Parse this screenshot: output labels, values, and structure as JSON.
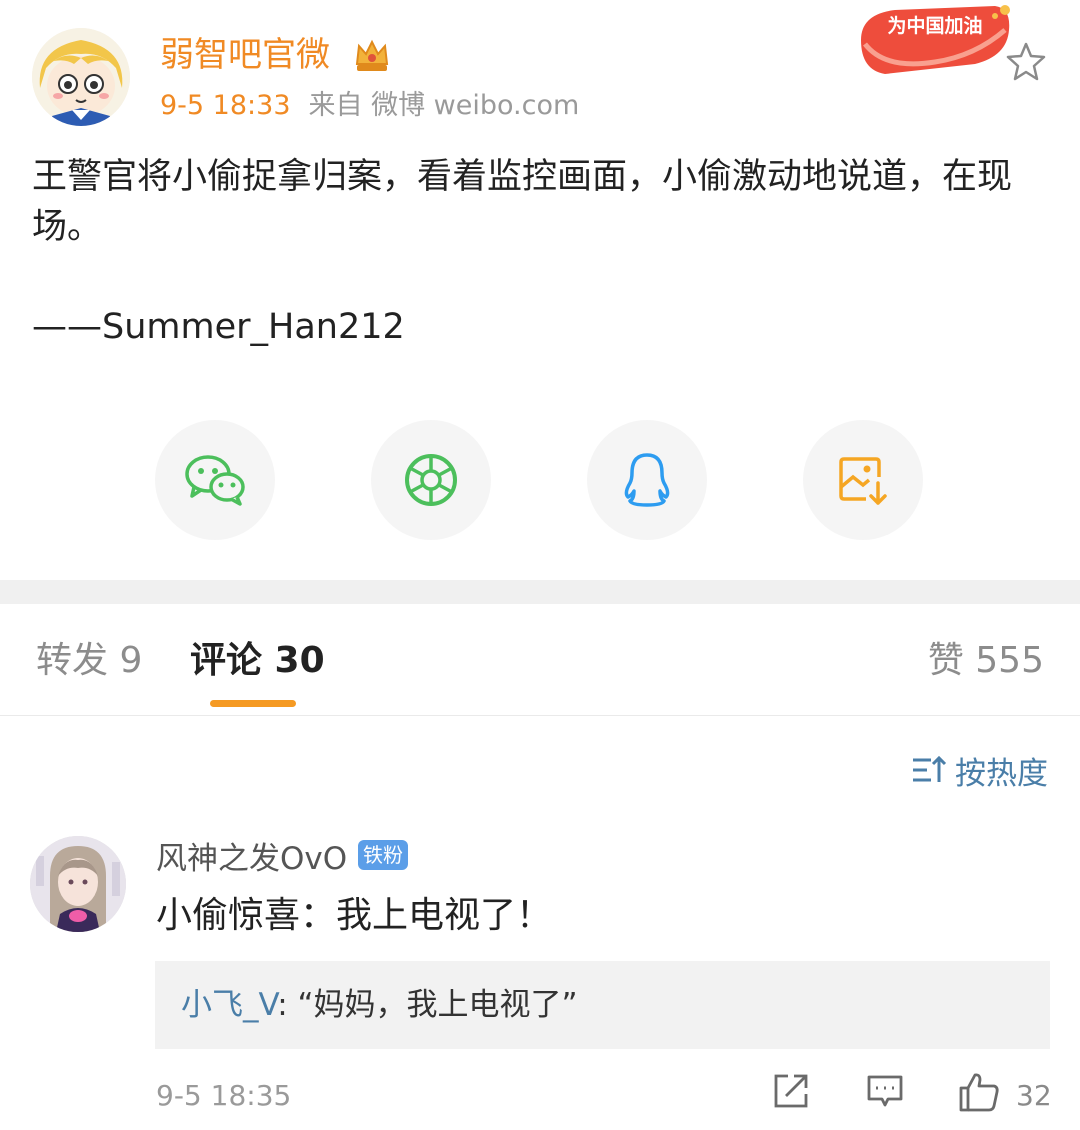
{
  "post": {
    "author": "弱智吧官微",
    "time": "9-5 18:33",
    "source": "来自 微博 weibo.com",
    "badge_text": "为中国加油",
    "body": "王警官将小偷捉拿归案，看着监控画面，小偷激动地说道，在现场。",
    "signature": "——Summer_Han212"
  },
  "share": {
    "items": [
      {
        "name": "wechat-icon",
        "color": "#4cbf5c"
      },
      {
        "name": "moments-icon",
        "color": "#4cbf5c"
      },
      {
        "name": "qq-icon",
        "color": "#2d9cf0"
      },
      {
        "name": "save-image-icon",
        "color": "#f5a623"
      }
    ]
  },
  "tabs": {
    "repost": "转发 9",
    "comment": "评论 30",
    "like": "赞 555"
  },
  "sort": {
    "label": "按热度"
  },
  "comments": [
    {
      "user": "风神之发OvO",
      "badge": "铁粉",
      "text": "小偷惊喜：我上电视了！",
      "reply_user": "小飞_V",
      "reply_text": ": “妈妈，我上电视了”",
      "time": "9-5 18:35",
      "like_count": "32"
    }
  ],
  "colors": {
    "accent_orange": "#f08a24",
    "tab_underline": "#f59a23",
    "link_blue": "#4a7ea8",
    "badge_blue": "#5b9ee8"
  }
}
